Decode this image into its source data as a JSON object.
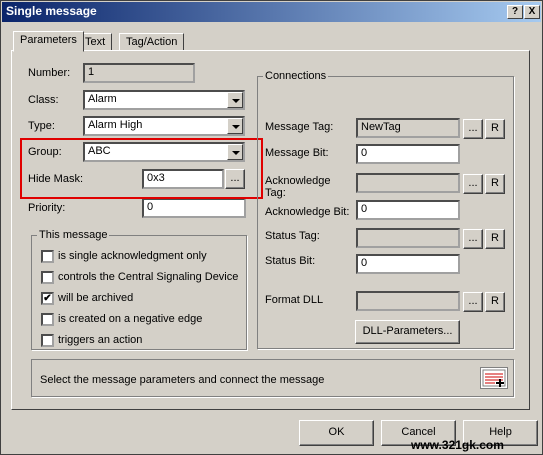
{
  "window": {
    "title": "Single message",
    "help_glyph": "?",
    "close_glyph": "X"
  },
  "tabs": [
    {
      "label": "Parameters"
    },
    {
      "label": "Text"
    },
    {
      "label": "Tag/Action"
    }
  ],
  "left": {
    "number_label": "Number:",
    "number_value": "1",
    "class_label": "Class:",
    "class_value": "Alarm",
    "type_label": "Type:",
    "type_value": "Alarm High",
    "group_label": "Group:",
    "group_value": "ABC",
    "hide_mask_label": "Hide Mask:",
    "hide_mask_value": "0x3",
    "hide_mask_button": "...",
    "priority_label": "Priority:",
    "priority_value": "0"
  },
  "this_message": {
    "legend": "This message",
    "options": [
      {
        "label": "is single acknowledgment only",
        "checked": false,
        "mark": ""
      },
      {
        "label": "controls the Central Signaling Device",
        "checked": false,
        "mark": ""
      },
      {
        "label": "will be archived",
        "checked": true,
        "mark": "✔"
      },
      {
        "label": "is created on a negative edge",
        "checked": false,
        "mark": ""
      },
      {
        "label": "triggers an action",
        "checked": false,
        "mark": ""
      }
    ]
  },
  "connections": {
    "legend": "Connections",
    "message_tag_label": "Message Tag:",
    "message_tag_value": "NewTag",
    "message_bit_label": "Message Bit:",
    "message_bit_value": "0",
    "ack_tag_label_1": "Acknowledge",
    "ack_tag_label_2": "Tag:",
    "ack_tag_value": "",
    "ack_bit_label": "Acknowledge Bit:",
    "ack_bit_value": "0",
    "status_tag_label": "Status Tag:",
    "status_tag_value": "",
    "status_bit_label": "Status Bit:",
    "status_bit_value": "0",
    "format_dll_label": "Format DLL",
    "format_dll_value": "",
    "browse_label": "...",
    "r_label": "R",
    "dll_params_label": "DLL-Parameters..."
  },
  "hint": {
    "text": "Select the message parameters and connect the message",
    "icon": "connect-message-icon"
  },
  "buttons": {
    "ok": "OK",
    "cancel": "Cancel",
    "help": "Help"
  },
  "watermark": "www.321gk.com",
  "colors": {
    "titlebar_start": "#0a246a",
    "titlebar_end": "#a6caf0",
    "highlight": "#e00000",
    "face": "#d4d0c8"
  }
}
